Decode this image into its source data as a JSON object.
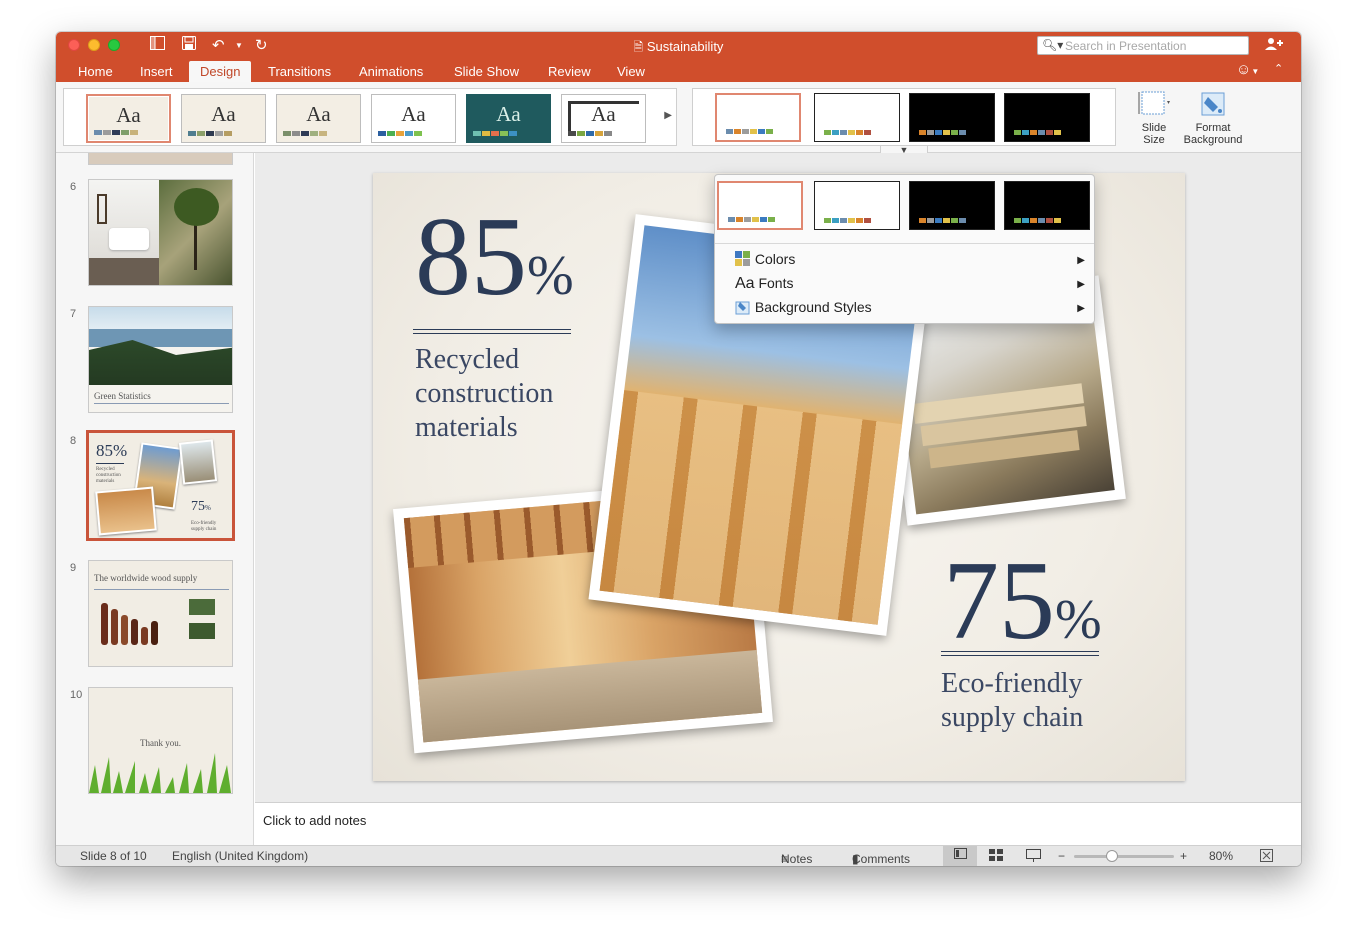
{
  "window": {
    "title": "Sustainability"
  },
  "search": {
    "placeholder": "Search in Presentation"
  },
  "tabs": [
    "Home",
    "Insert",
    "Design",
    "Transitions",
    "Animations",
    "Slide Show",
    "Review",
    "View"
  ],
  "active_tab": "Design",
  "themes": [
    {
      "label": "Aa",
      "bg": "#f3eee4",
      "colors": [
        "#6b8cad",
        "#9c9c9c",
        "#2f3b57",
        "#7e9e6a",
        "#c8b27a"
      ]
    },
    {
      "label": "Aa",
      "bg": "#f3eee4",
      "colors": [
        "#4f7d8f",
        "#8ca06a",
        "#2e3a50",
        "#a0a0a0",
        "#b59d62"
      ]
    },
    {
      "label": "Aa",
      "bg": "#f3eee4",
      "colors": [
        "#7a8f6a",
        "#8c8c8c",
        "#2f3b57",
        "#9fb07f",
        "#c7b47f"
      ]
    },
    {
      "label": "Aa",
      "bg": "#ffffff",
      "colors": [
        "#2b5fa0",
        "#4caf50",
        "#e8a33c",
        "#4b9ac9",
        "#7ec24f"
      ]
    },
    {
      "label": "Aa",
      "bg": "#1f5a5e",
      "colors": [
        "#6fbfb0",
        "#e0bb42",
        "#e46f4c",
        "#88c057",
        "#3c90c4"
      ]
    },
    {
      "label": "Aa",
      "bg": "#ffffff",
      "colors": [
        "#4a4a4a",
        "#7aa642",
        "#2f6aa8",
        "#d6a33b",
        "#888888"
      ]
    }
  ],
  "variants": [
    {
      "dark": false,
      "colors": [
        "#6b8cad",
        "#d9842b",
        "#9c9c9c",
        "#e1c14a",
        "#3b7bc0",
        "#7ab04a"
      ]
    },
    {
      "dark": false,
      "colors": [
        "#7ab04a",
        "#3b9fc2",
        "#6b8cad",
        "#e1c14a",
        "#d9842b",
        "#b05040"
      ]
    },
    {
      "dark": true,
      "colors": [
        "#d9842b",
        "#9c9c9c",
        "#3b7bc0",
        "#e1c14a",
        "#7ab04a",
        "#6b8cad"
      ]
    },
    {
      "dark": true,
      "colors": [
        "#7ab04a",
        "#3b9fc2",
        "#d9842b",
        "#6b8cad",
        "#b05040",
        "#e1c14a"
      ]
    }
  ],
  "ribbon_buttons": {
    "slide_size": "Slide Size",
    "format_background": "Format Background"
  },
  "dropdown": {
    "items": [
      {
        "label": "Colors",
        "icon": "colors-grid-icon"
      },
      {
        "label": "Fonts",
        "icon": "fonts-aa-icon"
      },
      {
        "label": "Background Styles",
        "icon": "paint-bucket-icon"
      }
    ]
  },
  "slides": [
    {
      "num": "6",
      "title": ""
    },
    {
      "num": "7",
      "title": "Green Statistics"
    },
    {
      "num": "8",
      "title": "85%"
    },
    {
      "num": "9",
      "title": "The worldwide wood supply"
    },
    {
      "num": "10",
      "title": "Thank you."
    }
  ],
  "slide": {
    "stat1_value": "85",
    "stat1_unit": "%",
    "stat1_label": [
      "Recycled",
      "construction",
      "materials"
    ],
    "stat2_value": "75",
    "stat2_unit": "%",
    "stat2_label": [
      "Eco-friendly",
      "supply chain"
    ]
  },
  "notes_placeholder": "Click to add notes",
  "status": {
    "slide_info": "Slide 8 of 10",
    "language": "English (United Kingdom)",
    "notes": "Notes",
    "comments": "Comments",
    "zoom": "80%",
    "zoom_fraction": 0.38
  },
  "icons": {
    "save": "save-icon",
    "undo": "undo-icon",
    "redo": "redo-icon",
    "sidebar": "sidebar-toggle-icon",
    "share": "add-person-icon",
    "smiley": "smiley-icon",
    "collapse": "chevron-up-icon"
  }
}
